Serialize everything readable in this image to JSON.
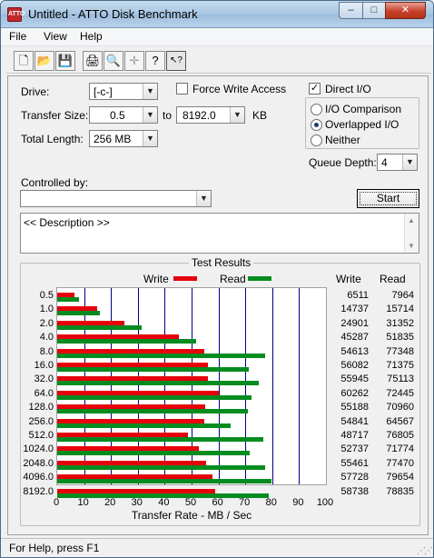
{
  "window": {
    "title": "Untitled - ATTO Disk Benchmark",
    "icon_label": "ATTO",
    "min_label": "–",
    "max_label": "□",
    "close_label": "✕"
  },
  "menu": [
    "File",
    "View",
    "Help"
  ],
  "toolbar": [
    "new-icon",
    "open-icon",
    "save-icon",
    "print-icon",
    "print-preview-icon",
    "move-icon",
    "help-icon",
    "context-help-icon"
  ],
  "toolbar_glyphs": [
    "🗋",
    "📂",
    "💾",
    "🖨",
    "🔍",
    "✛",
    "?",
    "↖?"
  ],
  "settings": {
    "drive_label": "Drive:",
    "drive_value": "[-c-]",
    "transfer_size_label": "Transfer Size:",
    "transfer_from": "0.5",
    "transfer_to_label": "to",
    "transfer_to": "8192.0",
    "transfer_unit": "KB",
    "total_length_label": "Total Length:",
    "total_length_value": "256 MB",
    "force_write_label": "Force Write Access",
    "force_write_checked": false,
    "direct_io_label": "Direct I/O",
    "direct_io_checked": true,
    "io_comparison_label": "I/O Comparison",
    "overlapped_io_label": "Overlapped I/O",
    "neither_label": "Neither",
    "selected_mode": "Overlapped I/O",
    "queue_depth_label": "Queue Depth:",
    "queue_depth_value": "4",
    "controlled_by_label": "Controlled by:",
    "controlled_by_value": "",
    "start_label": "Start",
    "description": "<< Description >>",
    "check_mark": "✓",
    "combo_arrow": "▼"
  },
  "results": {
    "title": "Test Results",
    "write_legend": "Write",
    "read_legend": "Read",
    "write_header": "Write",
    "read_header": "Read",
    "write_color": "#e5000c",
    "read_color": "#058c20"
  },
  "chart_data": {
    "type": "bar",
    "orientation": "horizontal",
    "categories": [
      "0.5",
      "1.0",
      "2.0",
      "4.0",
      "8.0",
      "16.0",
      "32.0",
      "64.0",
      "128.0",
      "256.0",
      "512.0",
      "1024.0",
      "2048.0",
      "4096.0",
      "8192.0"
    ],
    "series": [
      {
        "name": "Write",
        "values": [
          6511,
          14737,
          24901,
          45287,
          54613,
          56082,
          55945,
          60262,
          55188,
          54841,
          48717,
          52737,
          55461,
          57728,
          58738
        ]
      },
      {
        "name": "Read",
        "values": [
          7964,
          15714,
          31352,
          51835,
          77348,
          71375,
          75113,
          72445,
          70960,
          64567,
          76805,
          71774,
          77470,
          79654,
          78835
        ]
      }
    ],
    "x_ticks": [
      0,
      10,
      20,
      30,
      40,
      50,
      60,
      70,
      80,
      90,
      100
    ],
    "xlim": [
      0,
      100
    ],
    "xlabel": "Transfer Rate - MB / Sec",
    "value_unit_divisor": 1000,
    "legend_position": "top",
    "grid": true
  },
  "status": {
    "text": "For Help, press F1",
    "grip": "⋰⋰"
  }
}
